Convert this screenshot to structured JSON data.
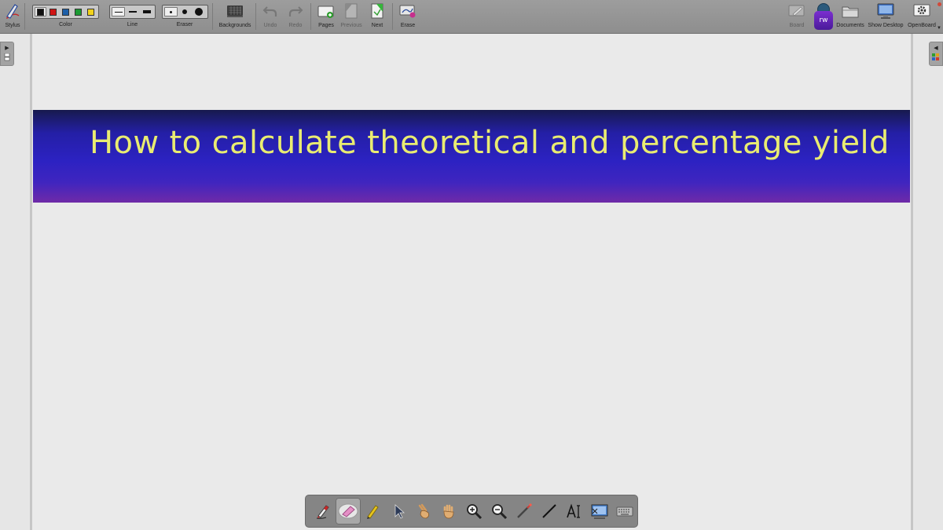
{
  "toolbar": {
    "stylus": {
      "label": "Stylus",
      "icon": "stylus-icon"
    },
    "color": {
      "label": "Color",
      "swatches": [
        "#111111",
        "#d01515",
        "#1d5fa8",
        "#1b9a33",
        "#f2d21b"
      ],
      "selected_index": 0
    },
    "line": {
      "label": "Line",
      "widths": [
        1,
        2,
        4
      ],
      "selected_index": 0
    },
    "eraser": {
      "label": "Eraser",
      "sizes": [
        3,
        6,
        10
      ],
      "selected_index": 0
    },
    "backgrounds": {
      "label": "Backgrounds",
      "icon": "backgrounds-icon"
    },
    "undo": {
      "label": "Undo",
      "icon": "undo-icon",
      "enabled": false
    },
    "redo": {
      "label": "Redo",
      "icon": "redo-icon",
      "enabled": false
    },
    "pages": {
      "label": "Pages",
      "icon": "pages-icon"
    },
    "previous": {
      "label": "Previous",
      "icon": "previous-page-icon",
      "enabled": false
    },
    "next": {
      "label": "Next",
      "icon": "next-page-icon"
    },
    "erase": {
      "label": "Erase",
      "icon": "erase-board-icon"
    },
    "board": {
      "label": "Board",
      "icon": "board-icon"
    },
    "documents": {
      "label": "Documents",
      "icon": "folder-icon"
    },
    "show_desktop": {
      "label": "Show Desktop",
      "icon": "monitor-icon"
    },
    "openboard": {
      "label": "OpenBoard",
      "icon": "gear-icon"
    },
    "screen_recorder": {
      "badge": "rw",
      "icon": "screen-recorder-icon"
    }
  },
  "board": {
    "title": "How to calculate theoretical and percentage yield",
    "banner_colors": [
      "#171a4e",
      "#2c22c2",
      "#6f2aa8"
    ],
    "title_color": "#e9ec71"
  },
  "palette": {
    "tools": [
      {
        "name": "pen-tool",
        "icon": "pen-icon"
      },
      {
        "name": "eraser-tool",
        "icon": "eraser-icon",
        "active": true
      },
      {
        "name": "marker-tool",
        "icon": "highlighter-icon"
      },
      {
        "name": "selector-tool",
        "icon": "arrow-pointer-icon"
      },
      {
        "name": "interact-tool",
        "icon": "pointing-hand-icon"
      },
      {
        "name": "hand-tool",
        "icon": "hand-icon"
      },
      {
        "name": "zoom-in-tool",
        "icon": "zoom-in-icon"
      },
      {
        "name": "zoom-out-tool",
        "icon": "zoom-out-icon"
      },
      {
        "name": "laser-pointer-tool",
        "icon": "laser-pointer-icon"
      },
      {
        "name": "line-tool",
        "icon": "line-icon"
      },
      {
        "name": "text-tool",
        "icon": "text-icon"
      },
      {
        "name": "capture-tool",
        "icon": "capture-icon"
      },
      {
        "name": "keyboard-tool",
        "icon": "keyboard-icon"
      }
    ]
  }
}
